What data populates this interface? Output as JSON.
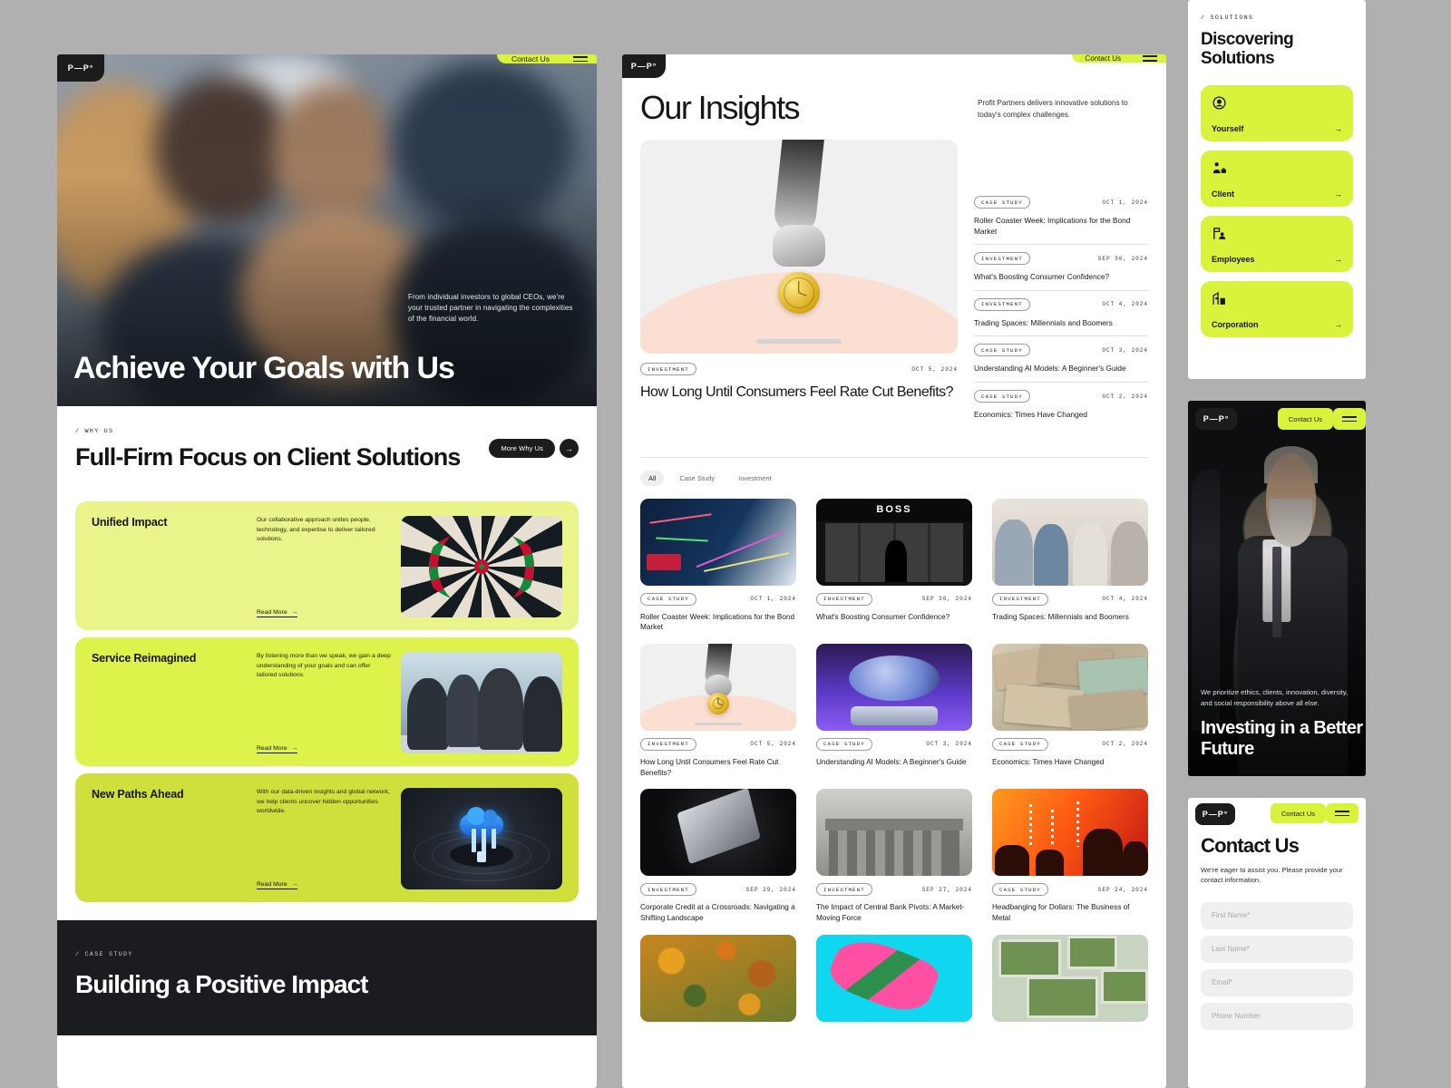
{
  "brand": {
    "logo": "P—P°",
    "name": "Profit Partners"
  },
  "nav": {
    "contact_label": "Contact Us",
    "menu_icon": "hamburger-menu-icon"
  },
  "hero": {
    "title": "Achieve Your Goals with Us",
    "subtitle": "From individual investors to global CEOs, we're your trusted partner in navigating the complexities of the financial world."
  },
  "why_us": {
    "eyebrow": "/ WHY US",
    "heading": "Full-Firm Focus on Client Solutions",
    "cta_label": "More Why Us",
    "cta_arrow": "→",
    "cards": [
      {
        "title": "Unified Impact",
        "desc": "Our collaborative approach unites people, technology, and expertise to deliver tailored solutions.",
        "link": "Read More",
        "image": "dartboard-image"
      },
      {
        "title": "Service Reimagined",
        "desc": "By listening more than we speak, we gain a deep understanding of your goals and can offer tailored solutions.",
        "link": "Read More",
        "image": "meeting-photo"
      },
      {
        "title": "New Paths Ahead",
        "desc": "With our data-driven insights and global network, we help clients uncover hidden opportunities worldwide.",
        "link": "Read More",
        "image": "cloud-tech-render"
      }
    ]
  },
  "case_study_band": {
    "eyebrow": "/ CASE STUDY",
    "heading": "Building a Positive Impact"
  },
  "insights": {
    "title": "Our Insights",
    "blurb": "Profit Partners delivers innovative solutions to today's complex challenges.",
    "featured": {
      "tag": "INVESTMENT",
      "date": "OCT 5, 2024",
      "title": "How Long Until Consumers Feel Rate Cut Benefits?",
      "image": "hand-holding-clock-coin"
    },
    "side_list": [
      {
        "tag": "CASE STUDY",
        "date": "OCT 1, 2024",
        "title": "Roller Coaster Week: Implications for the Bond Market"
      },
      {
        "tag": "INVESTMENT",
        "date": "SEP 30, 2024",
        "title": "What's Boosting Consumer Confidence?"
      },
      {
        "tag": "INVESTMENT",
        "date": "OCT 4, 2024",
        "title": "Trading Spaces: Millennials and Boomers"
      },
      {
        "tag": "CASE STUDY",
        "date": "OCT 3, 2024",
        "title": "Understanding AI Models: A Beginner's Guide"
      },
      {
        "tag": "CASE STUDY",
        "date": "OCT 2, 2024",
        "title": "Economics: Times Have Changed"
      }
    ],
    "filters": [
      {
        "label": "All",
        "active": true
      },
      {
        "label": "Case Study",
        "active": false
      },
      {
        "label": "Investment",
        "active": false
      }
    ],
    "grid": [
      {
        "tag": "CASE STUDY",
        "date": "OCT 1, 2024",
        "title": "Roller Coaster Week: Implications for the Bond Market",
        "image": "stock-charts-screen"
      },
      {
        "tag": "INVESTMENT",
        "date": "SEP 30, 2024",
        "title": "What's Boosting Consumer Confidence?",
        "image": "boss-storefront"
      },
      {
        "tag": "INVESTMENT",
        "date": "OCT 4, 2024",
        "title": "Trading Spaces: Millennials and Boomers",
        "image": "young-people-table"
      },
      {
        "tag": "INVESTMENT",
        "date": "OCT 5, 2024",
        "title": "How Long Until Consumers Feel Rate Cut Benefits?",
        "image": "hand-holding-clock-coin"
      },
      {
        "tag": "CASE STUDY",
        "date": "OCT 3, 2024",
        "title": "Understanding AI Models: A Beginner's Guide",
        "image": "ai-network-render"
      },
      {
        "tag": "CASE STUDY",
        "date": "OCT 2, 2024",
        "title": "Economics: Times Have Changed",
        "image": "banknotes-pile"
      },
      {
        "tag": "INVESTMENT",
        "date": "SEP 29, 2024",
        "title": "Corporate Credit at a Crossroads: Navigating a Shifting Landscape",
        "image": "dark-laptop-render"
      },
      {
        "tag": "INVESTMENT",
        "date": "SEP 27, 2024",
        "title": "The Impact of Central Bank Pivots: A Market-Moving Force",
        "image": "central-bank-building"
      },
      {
        "tag": "CASE STUDY",
        "date": "SEP 24, 2024",
        "title": "Headbanging for Dollars: The Business of Metal",
        "image": "concert-crowd"
      },
      {
        "tag": "",
        "date": "",
        "title": "",
        "image": "autumn-forest"
      },
      {
        "tag": "",
        "date": "",
        "title": "",
        "image": "pink-glove-cyan"
      },
      {
        "tag": "",
        "date": "",
        "title": "",
        "image": "green-fields-aerial"
      }
    ]
  },
  "solutions": {
    "eyebrow": "/ SOLUTIONS",
    "title": "Discovering Solutions",
    "cards": [
      {
        "label": "Yourself",
        "icon": "user-circle-icon",
        "arrow": "→"
      },
      {
        "label": "Client",
        "icon": "person-briefcase-icon",
        "arrow": "→"
      },
      {
        "label": "Employees",
        "icon": "org-people-icon",
        "arrow": "→"
      },
      {
        "label": "Corporation",
        "icon": "building-icon",
        "arrow": "→"
      }
    ]
  },
  "investing": {
    "title": "Investing in a Better Future",
    "subtitle": "We prioritize ethics, clients, innovation, diversity, and social responsibility above all else."
  },
  "contact": {
    "title": "Contact Us",
    "subtitle": "We're eager to assist you. Please provide your contact information.",
    "fields": [
      {
        "placeholder": "First Name*"
      },
      {
        "placeholder": "Last Name*"
      },
      {
        "placeholder": "Email*"
      },
      {
        "placeholder": "Phone Number"
      }
    ]
  },
  "colors": {
    "lime": "#d9f23c",
    "lime_light": "#e9f58a",
    "lime_mid": "#ddf24a",
    "lime_dark": "#c8dd3a",
    "dark": "#1c1c1c",
    "page_bg": "#b0b0b0"
  }
}
